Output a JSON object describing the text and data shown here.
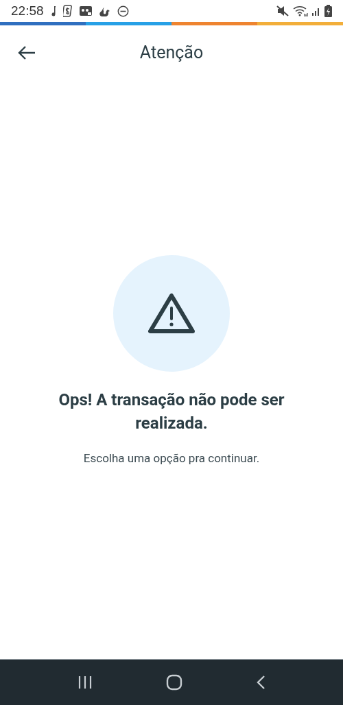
{
  "status_bar": {
    "time": "22:58"
  },
  "header": {
    "title": "Atenção"
  },
  "message": {
    "title": "Ops! A transação não pode ser realizada.",
    "subtitle": "Escolha uma opção pra continuar."
  }
}
